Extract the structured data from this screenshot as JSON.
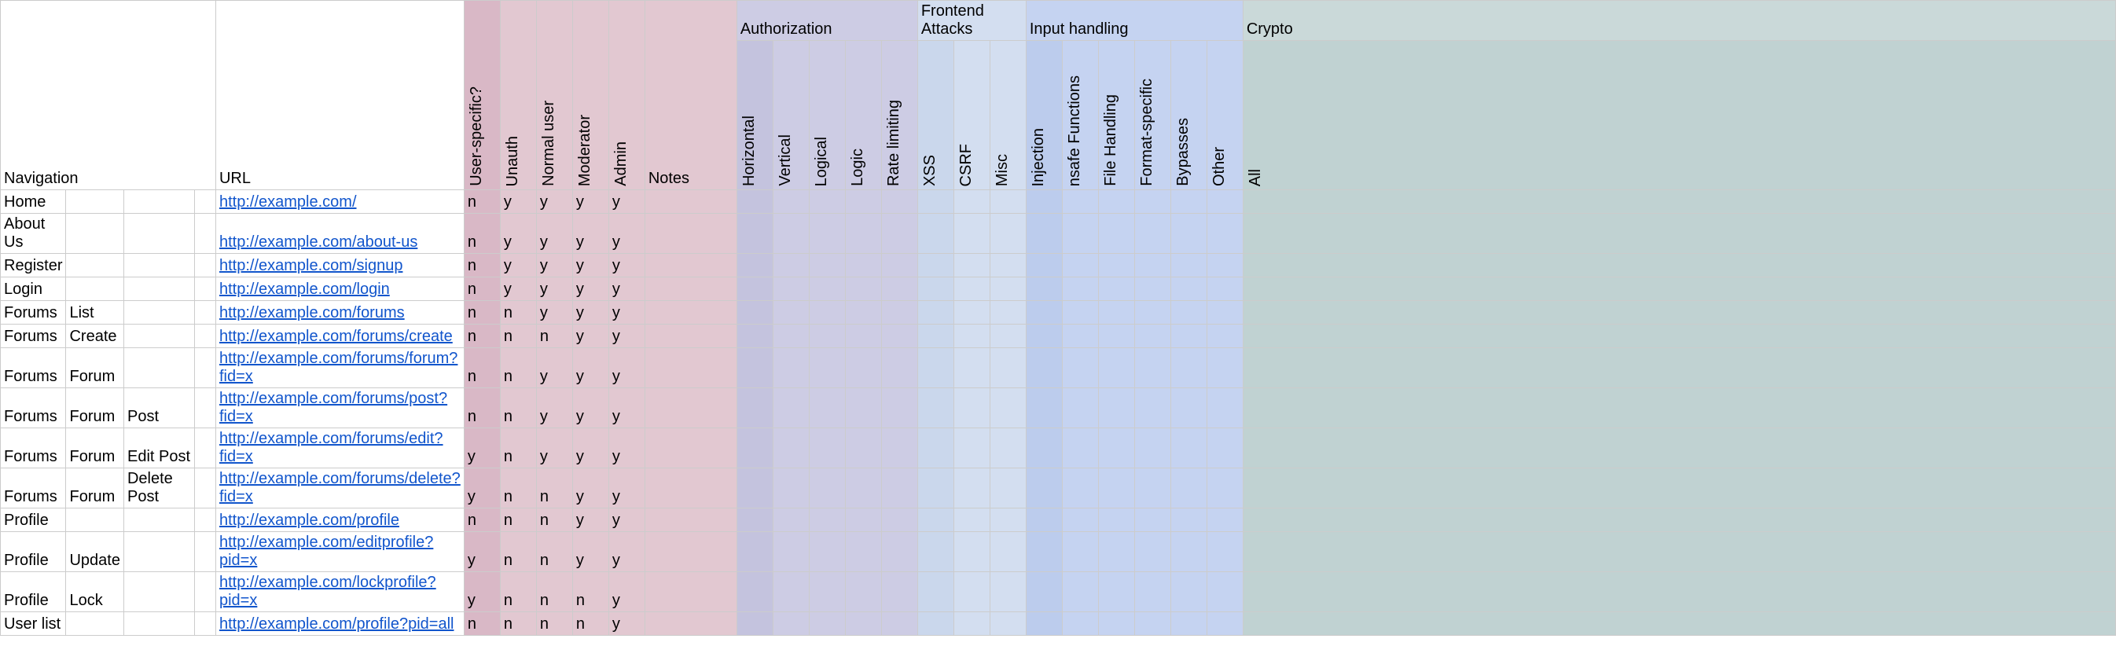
{
  "headers": {
    "groups": {
      "authorization": "Authorization",
      "frontend": "Frontend Attacks",
      "input": "Input handling",
      "crypto": "Crypto"
    },
    "navigation": "Navigation",
    "url": "URL",
    "sub": {
      "user_specific": "User-specific?",
      "unauth": "Unauth",
      "normal_user": "Normal user",
      "moderator": "Moderator",
      "admin": "Admin",
      "notes": "Notes",
      "horizontal": "Horizontal",
      "vertical": "Vertical",
      "logical": "Logical",
      "logic": "Logic",
      "rate_limiting": "Rate limiting",
      "xss": "XSS",
      "csrf": "CSRF",
      "misc": "Misc",
      "injection": "Injection",
      "unsafe_functions": "nsafe Functions",
      "file_handling": "File Handling",
      "format_specific": "Format-specific",
      "bypasses": "Bypasses",
      "other": "Other",
      "all": "All"
    }
  },
  "rows": [
    {
      "nav": [
        "Home",
        "",
        "",
        ""
      ],
      "url": "http://example.com/",
      "flags": [
        "n",
        "y",
        "y",
        "y",
        "y"
      ]
    },
    {
      "nav": [
        "About Us",
        "",
        "",
        ""
      ],
      "url": "http://example.com/about-us",
      "flags": [
        "n",
        "y",
        "y",
        "y",
        "y"
      ]
    },
    {
      "nav": [
        "Register",
        "",
        "",
        ""
      ],
      "url": "http://example.com/signup",
      "flags": [
        "n",
        "y",
        "y",
        "y",
        "y"
      ]
    },
    {
      "nav": [
        "Login",
        "",
        "",
        ""
      ],
      "url": "http://example.com/login",
      "flags": [
        "n",
        "y",
        "y",
        "y",
        "y"
      ]
    },
    {
      "nav": [
        "Forums",
        "List",
        "",
        ""
      ],
      "url": "http://example.com/forums",
      "flags": [
        "n",
        "n",
        "y",
        "y",
        "y"
      ]
    },
    {
      "nav": [
        "Forums",
        "Create",
        "",
        ""
      ],
      "url": "http://example.com/forums/create",
      "flags": [
        "n",
        "n",
        "n",
        "y",
        "y"
      ]
    },
    {
      "nav": [
        "Forums",
        "Forum",
        "",
        ""
      ],
      "url": "http://example.com/forums/forum?fid=x",
      "flags": [
        "n",
        "n",
        "y",
        "y",
        "y"
      ]
    },
    {
      "nav": [
        "Forums",
        "Forum",
        "Post",
        ""
      ],
      "url": "http://example.com/forums/post?fid=x",
      "flags": [
        "n",
        "n",
        "y",
        "y",
        "y"
      ]
    },
    {
      "nav": [
        "Forums",
        "Forum",
        "Edit Post",
        ""
      ],
      "url": "http://example.com/forums/edit?fid=x",
      "flags": [
        "y",
        "n",
        "y",
        "y",
        "y"
      ]
    },
    {
      "nav": [
        "Forums",
        "Forum",
        "Delete Post",
        ""
      ],
      "url": "http://example.com/forums/delete?fid=x",
      "flags": [
        "y",
        "n",
        "n",
        "y",
        "y"
      ]
    },
    {
      "nav": [
        "Profile",
        "",
        "",
        ""
      ],
      "url": "http://example.com/profile",
      "flags": [
        "n",
        "n",
        "n",
        "y",
        "y"
      ]
    },
    {
      "nav": [
        "Profile",
        "Update",
        "",
        ""
      ],
      "url": "http://example.com/editprofile?pid=x",
      "flags": [
        "y",
        "n",
        "n",
        "y",
        "y"
      ]
    },
    {
      "nav": [
        "Profile",
        "Lock",
        "",
        ""
      ],
      "url": "http://example.com/lockprofile?pid=x",
      "flags": [
        "y",
        "n",
        "n",
        "n",
        "y"
      ]
    },
    {
      "nav": [
        "User list",
        "",
        "",
        ""
      ],
      "url": "http://example.com/profile?pid=all",
      "flags": [
        "n",
        "n",
        "n",
        "n",
        "y"
      ]
    }
  ]
}
